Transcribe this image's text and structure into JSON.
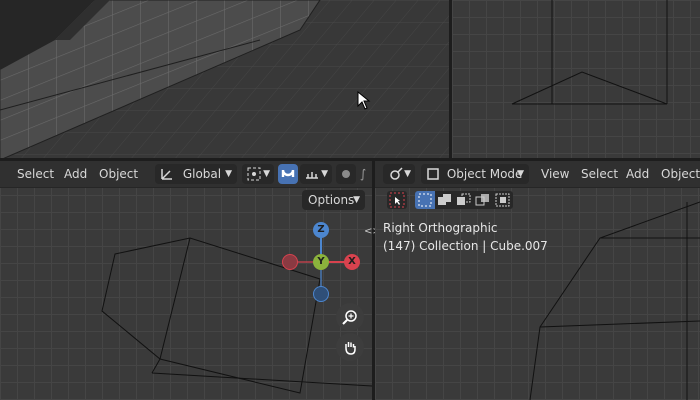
{
  "left_header": {
    "menu_select": "Select",
    "menu_add": "Add",
    "menu_object": "Object",
    "transform_orientation": "Global",
    "options_label": "Options"
  },
  "right_header": {
    "mode": "Object Mode",
    "menu_view": "View",
    "menu_select": "Select",
    "menu_add": "Add",
    "menu_object": "Object"
  },
  "viewport_info": {
    "view_name": "Right Orthographic",
    "collection_line": "(147) Collection | Cube.007"
  },
  "gizmo": {
    "axis_z": "Z",
    "axis_y": "Y",
    "axis_x": "X",
    "colors": {
      "x": "#d8424e",
      "y": "#8bb23c",
      "z": "#4c86cf"
    }
  },
  "icons": [
    "cursor-icon",
    "orientation-icon",
    "pivot-icon",
    "snap-magnet-icon",
    "snap-target-icon",
    "proportional-edit-icon",
    "falloff-icon",
    "editor-type-icon",
    "object-mode-icon",
    "select-box-icon",
    "select-mode-new-icon",
    "select-mode-extend-icon",
    "select-mode-subtract-icon",
    "select-mode-invert-icon",
    "select-mode-intersect-icon",
    "zoom-icon",
    "pan-hand-icon"
  ],
  "accent_color": "#4772b3"
}
